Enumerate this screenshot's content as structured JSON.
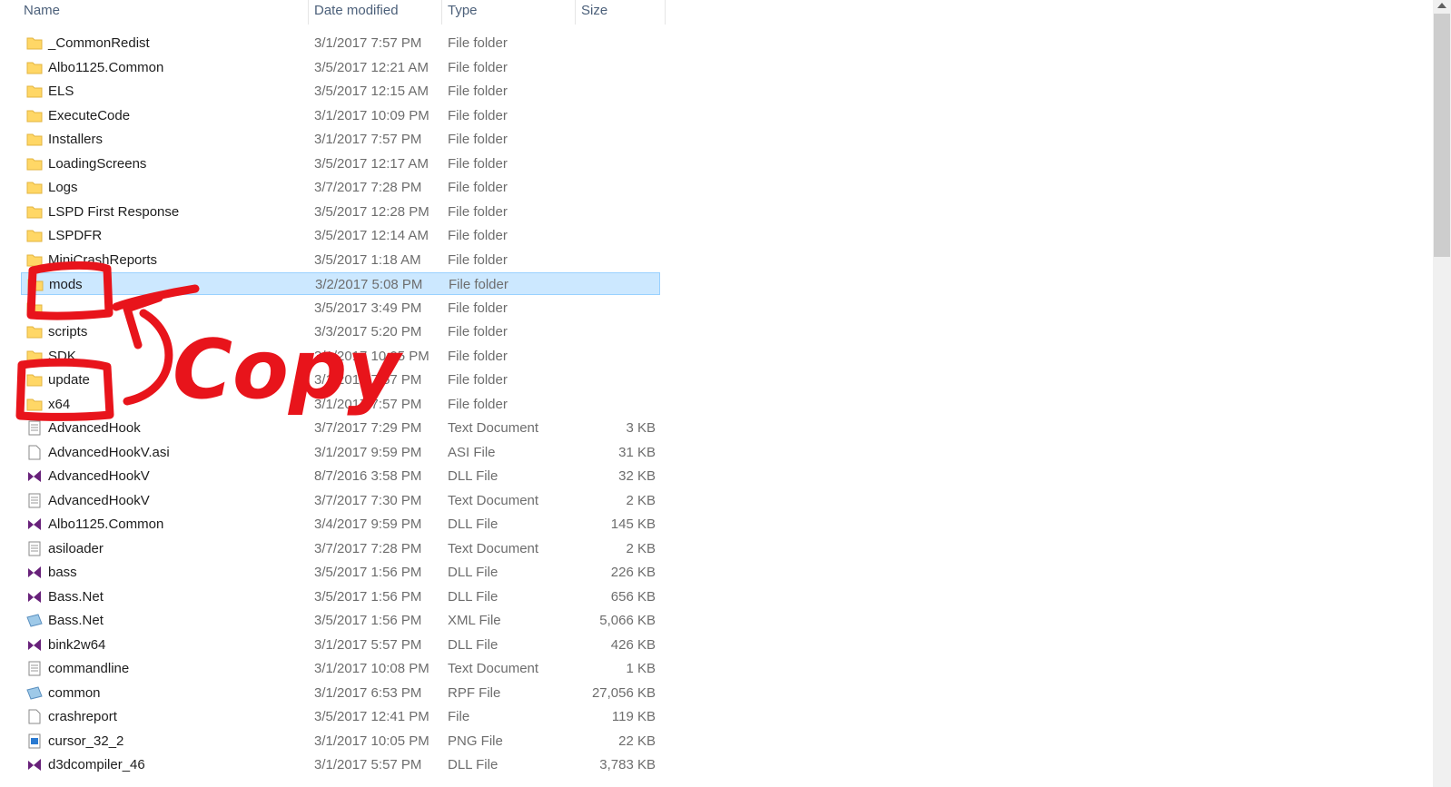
{
  "columns": {
    "name": "Name",
    "date_modified": "Date modified",
    "type": "Type",
    "size": "Size"
  },
  "colors": {
    "selection_bg": "#cce8ff",
    "selection_border": "#99d1ff",
    "folder_yellow": "#ffd766",
    "dll_purple": "#68217a",
    "annotation_red": "#e8141b"
  },
  "files": [
    {
      "name": "_CommonRedist",
      "date": "3/1/2017 7:57 PM",
      "type": "File folder",
      "size": "",
      "icon": "folder-icon"
    },
    {
      "name": "Albo1125.Common",
      "date": "3/5/2017 12:21 AM",
      "type": "File folder",
      "size": "",
      "icon": "folder-icon"
    },
    {
      "name": "ELS",
      "date": "3/5/2017 12:15 AM",
      "type": "File folder",
      "size": "",
      "icon": "folder-icon"
    },
    {
      "name": "ExecuteCode",
      "date": "3/1/2017 10:09 PM",
      "type": "File folder",
      "size": "",
      "icon": "folder-icon"
    },
    {
      "name": "Installers",
      "date": "3/1/2017 7:57 PM",
      "type": "File folder",
      "size": "",
      "icon": "folder-icon"
    },
    {
      "name": "LoadingScreens",
      "date": "3/5/2017 12:17 AM",
      "type": "File folder",
      "size": "",
      "icon": "folder-icon"
    },
    {
      "name": "Logs",
      "date": "3/7/2017 7:28 PM",
      "type": "File folder",
      "size": "",
      "icon": "folder-icon"
    },
    {
      "name": "LSPD First Response",
      "date": "3/5/2017 12:28 PM",
      "type": "File folder",
      "size": "",
      "icon": "folder-icon"
    },
    {
      "name": "LSPDFR",
      "date": "3/5/2017 12:14 AM",
      "type": "File folder",
      "size": "",
      "icon": "folder-icon"
    },
    {
      "name": "MiniCrashReports",
      "date": "3/5/2017 1:18 AM",
      "type": "File folder",
      "size": "",
      "icon": "folder-icon"
    },
    {
      "name": "mods",
      "date": "3/2/2017 5:08 PM",
      "type": "File folder",
      "size": "",
      "icon": "folder-icon",
      "selected": true
    },
    {
      "name": "",
      "date": "3/5/2017 3:49 PM",
      "type": "File folder",
      "size": "",
      "icon": "folder-icon"
    },
    {
      "name": "scripts",
      "date": "3/3/2017 5:20 PM",
      "type": "File folder",
      "size": "",
      "icon": "folder-icon"
    },
    {
      "name": "SDK",
      "date": "3/1/2017 10:05 PM",
      "type": "File folder",
      "size": "",
      "icon": "folder-icon"
    },
    {
      "name": "update",
      "date": "3/1/2017 7:57 PM",
      "type": "File folder",
      "size": "",
      "icon": "folder-icon"
    },
    {
      "name": "x64",
      "date": "3/1/2017 7:57 PM",
      "type": "File folder",
      "size": "",
      "icon": "folder-icon"
    },
    {
      "name": "AdvancedHook",
      "date": "3/7/2017 7:29 PM",
      "type": "Text Document",
      "size": "3 KB",
      "icon": "text-document-icon"
    },
    {
      "name": "AdvancedHookV.asi",
      "date": "3/1/2017 9:59 PM",
      "type": "ASI File",
      "size": "31 KB",
      "icon": "blank-file-icon"
    },
    {
      "name": "AdvancedHookV",
      "date": "8/7/2016 3:58 PM",
      "type": "DLL File",
      "size": "32 KB",
      "icon": "dll-file-icon"
    },
    {
      "name": "AdvancedHookV",
      "date": "3/7/2017 7:30 PM",
      "type": "Text Document",
      "size": "2 KB",
      "icon": "text-document-icon"
    },
    {
      "name": "Albo1125.Common",
      "date": "3/4/2017 9:59 PM",
      "type": "DLL File",
      "size": "145 KB",
      "icon": "dll-file-icon"
    },
    {
      "name": "asiloader",
      "date": "3/7/2017 7:28 PM",
      "type": "Text Document",
      "size": "2 KB",
      "icon": "text-document-icon"
    },
    {
      "name": "bass",
      "date": "3/5/2017 1:56 PM",
      "type": "DLL File",
      "size": "226 KB",
      "icon": "dll-file-icon"
    },
    {
      "name": "Bass.Net",
      "date": "3/5/2017 1:56 PM",
      "type": "DLL File",
      "size": "656 KB",
      "icon": "dll-file-icon"
    },
    {
      "name": "Bass.Net",
      "date": "3/5/2017 1:56 PM",
      "type": "XML File",
      "size": "5,066 KB",
      "icon": "xml-file-icon"
    },
    {
      "name": "bink2w64",
      "date": "3/1/2017 5:57 PM",
      "type": "DLL File",
      "size": "426 KB",
      "icon": "dll-file-icon"
    },
    {
      "name": "commandline",
      "date": "3/1/2017 10:08 PM",
      "type": "Text Document",
      "size": "1 KB",
      "icon": "text-document-icon"
    },
    {
      "name": "common",
      "date": "3/1/2017 6:53 PM",
      "type": "RPF File",
      "size": "27,056 KB",
      "icon": "rpf-file-icon"
    },
    {
      "name": "crashreport",
      "date": "3/5/2017 12:41 PM",
      "type": "File",
      "size": "119 KB",
      "icon": "blank-file-icon"
    },
    {
      "name": "cursor_32_2",
      "date": "3/1/2017 10:05 PM",
      "type": "PNG File",
      "size": "22 KB",
      "icon": "png-file-icon"
    },
    {
      "name": "d3dcompiler_46",
      "date": "3/1/2017 5:57 PM",
      "type": "DLL File",
      "size": "3,783 KB",
      "icon": "dll-file-icon"
    }
  ],
  "annotation": {
    "text": "Copy"
  }
}
